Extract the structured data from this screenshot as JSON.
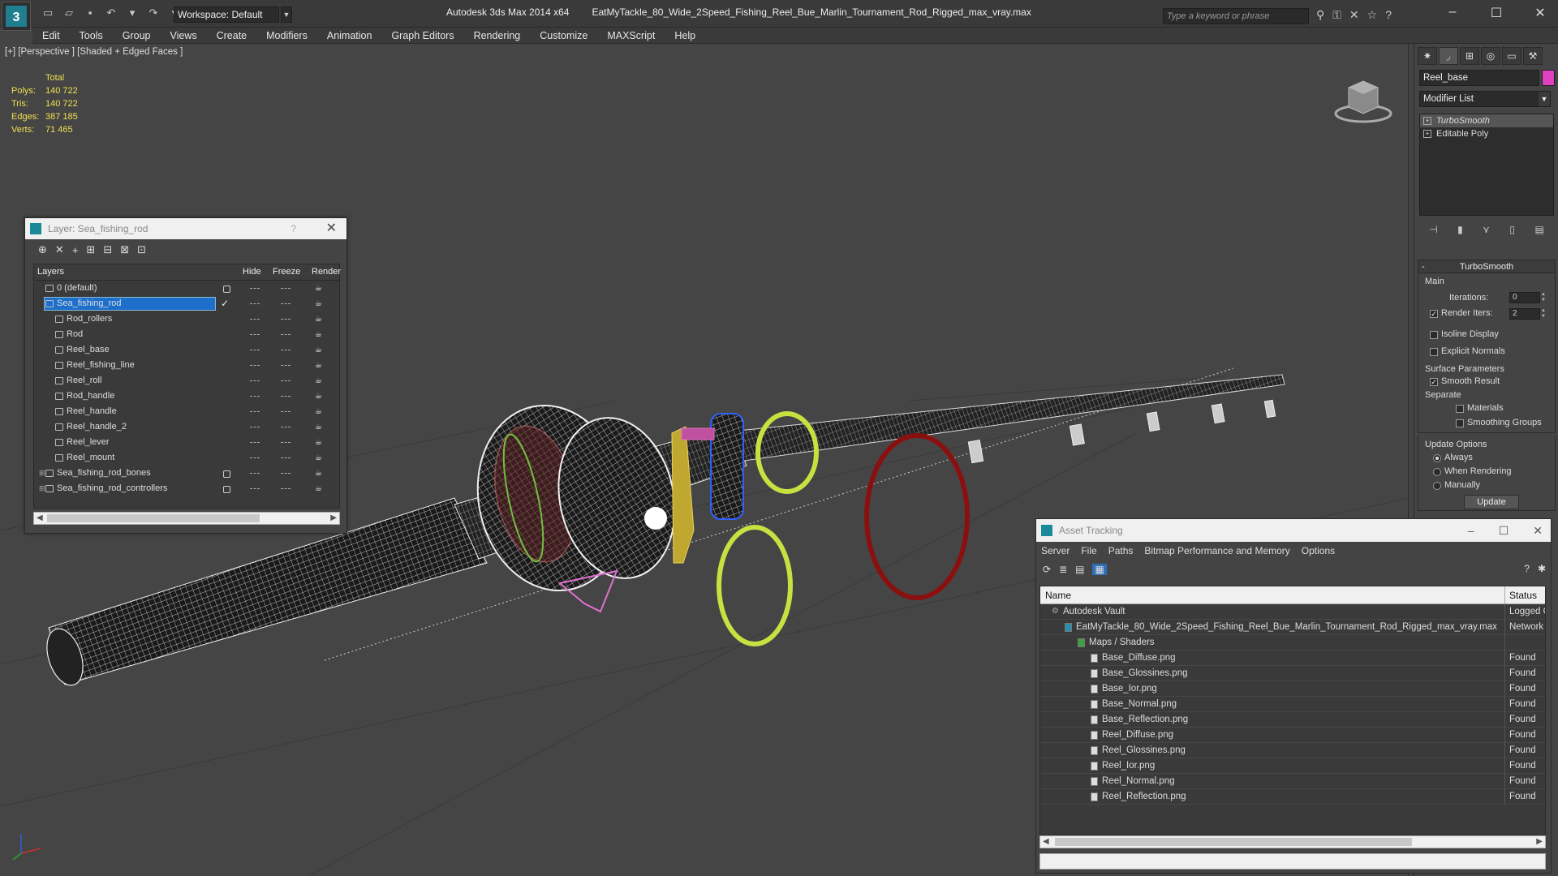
{
  "titlebar": {
    "workspace": "Workspace: Default",
    "app_title": "Autodesk 3ds Max  2014 x64",
    "file_title": "EatMyTackle_80_Wide_2Speed_Fishing_Reel_Bue_Marlin_Tournament_Rod_Rigged_max_vray.max",
    "search_placeholder": "Type a keyword or phrase"
  },
  "menu": [
    "Edit",
    "Tools",
    "Group",
    "Views",
    "Create",
    "Modifiers",
    "Animation",
    "Graph Editors",
    "Rendering",
    "Customize",
    "MAXScript",
    "Help"
  ],
  "viewport": {
    "label": "[+] [Perspective ] [Shaded + Edged Faces ]",
    "stats": {
      "header": "Total",
      "rows": [
        {
          "k": "Polys:",
          "v": "140 722"
        },
        {
          "k": "Tris:",
          "v": "140 722"
        },
        {
          "k": "Edges:",
          "v": "387 185"
        },
        {
          "k": "Verts:",
          "v": "71 465"
        }
      ]
    }
  },
  "command_panel": {
    "object_name": "Reel_base",
    "object_color": "#e040c0",
    "modifier_list": "Modifier List",
    "stack": [
      "TurboSmooth",
      "Editable Poly"
    ],
    "rollout_title": "TurboSmooth",
    "main_label": "Main",
    "iterations_label": "Iterations:",
    "iterations_value": "0",
    "render_iters_label": "Render Iters:",
    "render_iters_value": "2",
    "isoline": "Isoline Display",
    "explicit_normals": "Explicit Normals",
    "surface_params": "Surface Parameters",
    "smooth_result": "Smooth Result",
    "separate": "Separate",
    "materials": "Materials",
    "smoothing_groups": "Smoothing Groups",
    "update_options": "Update Options",
    "always": "Always",
    "when_rendering": "When Rendering",
    "manually": "Manually",
    "update_button": "Update"
  },
  "layer_dialog": {
    "title": "Layer: Sea_fishing_rod",
    "help": "?",
    "columns": {
      "layers": "Layers",
      "hide": "Hide",
      "freeze": "Freeze",
      "render": "Render"
    },
    "rows": [
      {
        "name": "0 (default)",
        "indent": 1
      },
      {
        "name": "Sea_fishing_rod",
        "indent": 1
      },
      {
        "name": "Rod_rollers",
        "indent": 2
      },
      {
        "name": "Rod",
        "indent": 2
      },
      {
        "name": "Reel_base",
        "indent": 2
      },
      {
        "name": "Reel_fishing_line",
        "indent": 2
      },
      {
        "name": "Reel_roll",
        "indent": 2
      },
      {
        "name": "Rod_handle",
        "indent": 2
      },
      {
        "name": "Reel_handle",
        "indent": 2
      },
      {
        "name": "Reel_handle_2",
        "indent": 2
      },
      {
        "name": "Reel_lever",
        "indent": 2
      },
      {
        "name": "Reel_mount",
        "indent": 2
      },
      {
        "name": "Sea_fishing_rod_bones",
        "indent": 1
      },
      {
        "name": "Sea_fishing_rod_controllers",
        "indent": 1
      }
    ]
  },
  "asset_dialog": {
    "title": "Asset Tracking",
    "menu": [
      "Server",
      "File",
      "Paths",
      "Bitmap Performance and Memory",
      "Options"
    ],
    "columns": {
      "name": "Name",
      "status": "Status"
    },
    "rows": [
      {
        "name": "Autodesk Vault",
        "status": "Logged O",
        "indent": 0,
        "icon": "vault"
      },
      {
        "name": "EatMyTackle_80_Wide_2Speed_Fishing_Reel_Bue_Marlin_Tournament_Rod_Rigged_max_vray.max",
        "status": "Network",
        "indent": 1,
        "icon": "file"
      },
      {
        "name": "Maps / Shaders",
        "status": "",
        "indent": 2,
        "icon": "folder"
      },
      {
        "name": "Base_Diffuse.png",
        "status": "Found",
        "indent": 3,
        "icon": "image"
      },
      {
        "name": "Base_Glossines.png",
        "status": "Found",
        "indent": 3,
        "icon": "image"
      },
      {
        "name": "Base_Ior.png",
        "status": "Found",
        "indent": 3,
        "icon": "image"
      },
      {
        "name": "Base_Normal.png",
        "status": "Found",
        "indent": 3,
        "icon": "image"
      },
      {
        "name": "Base_Reflection.png",
        "status": "Found",
        "indent": 3,
        "icon": "image"
      },
      {
        "name": "Reel_Diffuse.png",
        "status": "Found",
        "indent": 3,
        "icon": "image"
      },
      {
        "name": "Reel_Glossines.png",
        "status": "Found",
        "indent": 3,
        "icon": "image"
      },
      {
        "name": "Reel_Ior.png",
        "status": "Found",
        "indent": 3,
        "icon": "image"
      },
      {
        "name": "Reel_Normal.png",
        "status": "Found",
        "indent": 3,
        "icon": "image"
      },
      {
        "name": "Reel_Reflection.png",
        "status": "Found",
        "indent": 3,
        "icon": "image"
      }
    ]
  }
}
